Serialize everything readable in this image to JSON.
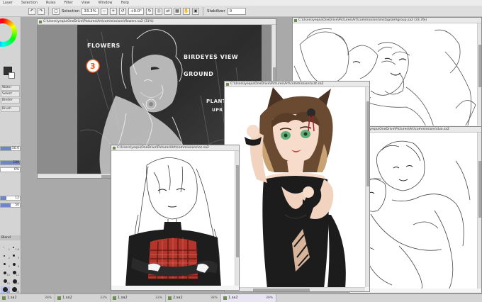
{
  "menu": [
    "Layer",
    "Selection",
    "Rules",
    "Filter",
    "View",
    "Window",
    "Help"
  ],
  "toolbar": {
    "selection_label": "Selection",
    "zoom": "33.3%",
    "rotation": "+0.0°",
    "stabilizer_label": "Stabilizer",
    "stabilizer_value": "0"
  },
  "left_panel": {
    "tools": [
      "Water",
      "Select",
      "Binder",
      "Brush"
    ],
    "sliders": [
      "50.0",
      "100",
      "0%",
      "12",
      "50"
    ],
    "blend_label": "Blend",
    "brush_sizes": [
      "1",
      "1.6",
      "2",
      "3",
      "5",
      "8",
      "10",
      "12",
      "15",
      "20",
      "25",
      "30"
    ]
  },
  "windows": {
    "w1_title": "C:\\Users\\yeqiu\\OneDrive\\Pictures\\Art\\commissions\\flowers.sa2 (33%)",
    "w2_title": "C:\\Users\\yeqiu\\OneDrive\\Pictures\\Art\\commissions\\instagram\\group.sa2 (33.3%)",
    "w3_title": "C:\\Users\\yeqiu\\OneDrive\\Pictures\\Art\\commissions\\oc.sa2",
    "w4_title": "C:\\Users\\yeqiu\\OneDrive\\Pictures\\Art\\commissions\\cat.sa2",
    "w5_title": "C:\\Users\\yeqiu\\OneDrive\\Pictures\\Art\\commissions\\duo.sa2"
  },
  "sketch_notes": {
    "flowers": "FLOWERS",
    "number": "3",
    "birdseye": "BIRDEYES VIEW",
    "ground": "GROUND",
    "plants1": "PLANT",
    "plants2": "UPR"
  },
  "tabs": [
    {
      "label": "1.sa2",
      "zoom": "39%"
    },
    {
      "label": "1.sa2",
      "zoom": "33%"
    },
    {
      "label": "1.sa2",
      "zoom": "33%"
    },
    {
      "label": "2.sa2",
      "zoom": "38%"
    },
    {
      "label": "1.sa2",
      "zoom": "39%"
    }
  ]
}
